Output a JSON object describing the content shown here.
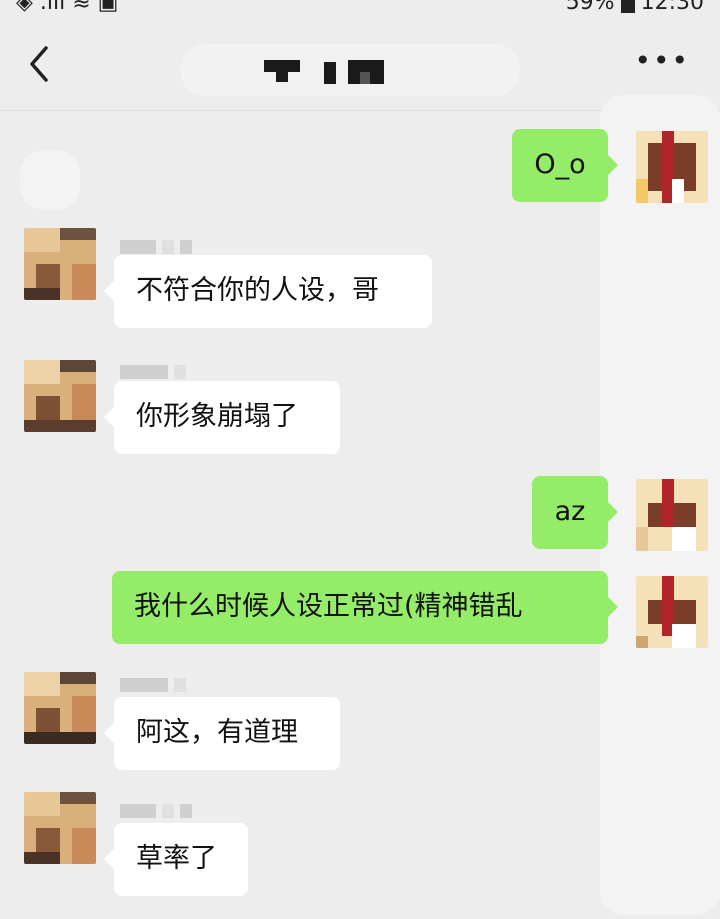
{
  "status_bar": {
    "battery_text": "59%",
    "time": "12:30"
  },
  "nav": {
    "back_icon": "chevron-left-icon",
    "more_label": "•••"
  },
  "messages": [
    {
      "side": "out",
      "text": "O_o"
    },
    {
      "side": "in",
      "text": "不符合你的人设，哥"
    },
    {
      "side": "in",
      "text": "你形象崩塌了"
    },
    {
      "side": "out",
      "text": "az"
    },
    {
      "side": "out",
      "text": "我什么时候人设正常过(精神错乱"
    },
    {
      "side": "in",
      "text": "阿这，有道理"
    },
    {
      "side": "in",
      "text": "草率了"
    }
  ],
  "colors": {
    "background": "#ededed",
    "outgoing_bubble": "#95ec69",
    "incoming_bubble": "#ffffff"
  }
}
